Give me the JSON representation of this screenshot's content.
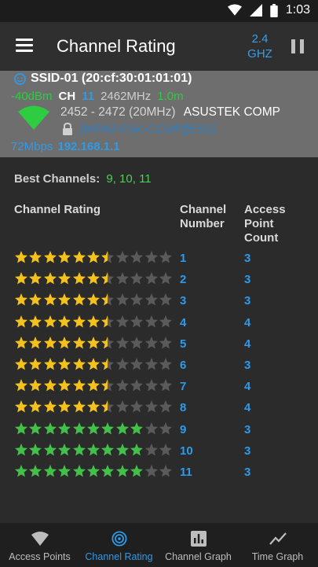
{
  "status_bar": {
    "time": "1:03"
  },
  "app_bar": {
    "title": "Channel Rating",
    "band_line1": "2.4",
    "band_line2": "GHZ"
  },
  "network": {
    "ssid": "SSID-01 (20:cf:30:01:01:01)",
    "signal": "-40dBm",
    "ch_label": "CH",
    "channel": "11",
    "frequency": "2462MHz",
    "distance": "1.0m",
    "range": "2452 - 2472",
    "width": "(20MHz)",
    "vendor": "ASUSTEK COMP",
    "security": "[WPA2-PSK-CCMP][ESS]",
    "speed": "72Mbps",
    "ip": "192.168.1.1"
  },
  "best_channels": {
    "label": "Best Channels:",
    "values": "9, 10, 11"
  },
  "table": {
    "col_rating": "Channel Rating",
    "col_channel_line1": "Channel",
    "col_channel_line2": "Number",
    "col_ap_line1": "Access",
    "col_ap_line2": "Point",
    "col_ap_line3": "Count",
    "rows": [
      {
        "rating": 6.5,
        "color": "yellow",
        "channel": "1",
        "ap_count": "3"
      },
      {
        "rating": 6.5,
        "color": "yellow",
        "channel": "2",
        "ap_count": "3"
      },
      {
        "rating": 6.5,
        "color": "yellow",
        "channel": "3",
        "ap_count": "3"
      },
      {
        "rating": 6.5,
        "color": "yellow",
        "channel": "4",
        "ap_count": "4"
      },
      {
        "rating": 6.5,
        "color": "yellow",
        "channel": "5",
        "ap_count": "4"
      },
      {
        "rating": 6.5,
        "color": "yellow",
        "channel": "6",
        "ap_count": "3"
      },
      {
        "rating": 6.5,
        "color": "yellow",
        "channel": "7",
        "ap_count": "4"
      },
      {
        "rating": 6.5,
        "color": "yellow",
        "channel": "8",
        "ap_count": "4"
      },
      {
        "rating": 9,
        "color": "green",
        "channel": "9",
        "ap_count": "3"
      },
      {
        "rating": 9,
        "color": "green",
        "channel": "10",
        "ap_count": "3"
      },
      {
        "rating": 9,
        "color": "green",
        "channel": "11",
        "ap_count": "3"
      }
    ],
    "max_stars": 11
  },
  "colors": {
    "yellow": "#f4c21a",
    "green": "#43c04a",
    "empty": "#5a5a5a",
    "accent": "#2f9ae8"
  },
  "bottom_nav": [
    {
      "label": "Access Points",
      "icon": "wifi-icon",
      "active": false
    },
    {
      "label": "Channel Rating",
      "icon": "radar-icon",
      "active": true
    },
    {
      "label": "Channel Graph",
      "icon": "bar-chart-icon",
      "active": false
    },
    {
      "label": "Time Graph",
      "icon": "line-chart-icon",
      "active": false
    }
  ]
}
